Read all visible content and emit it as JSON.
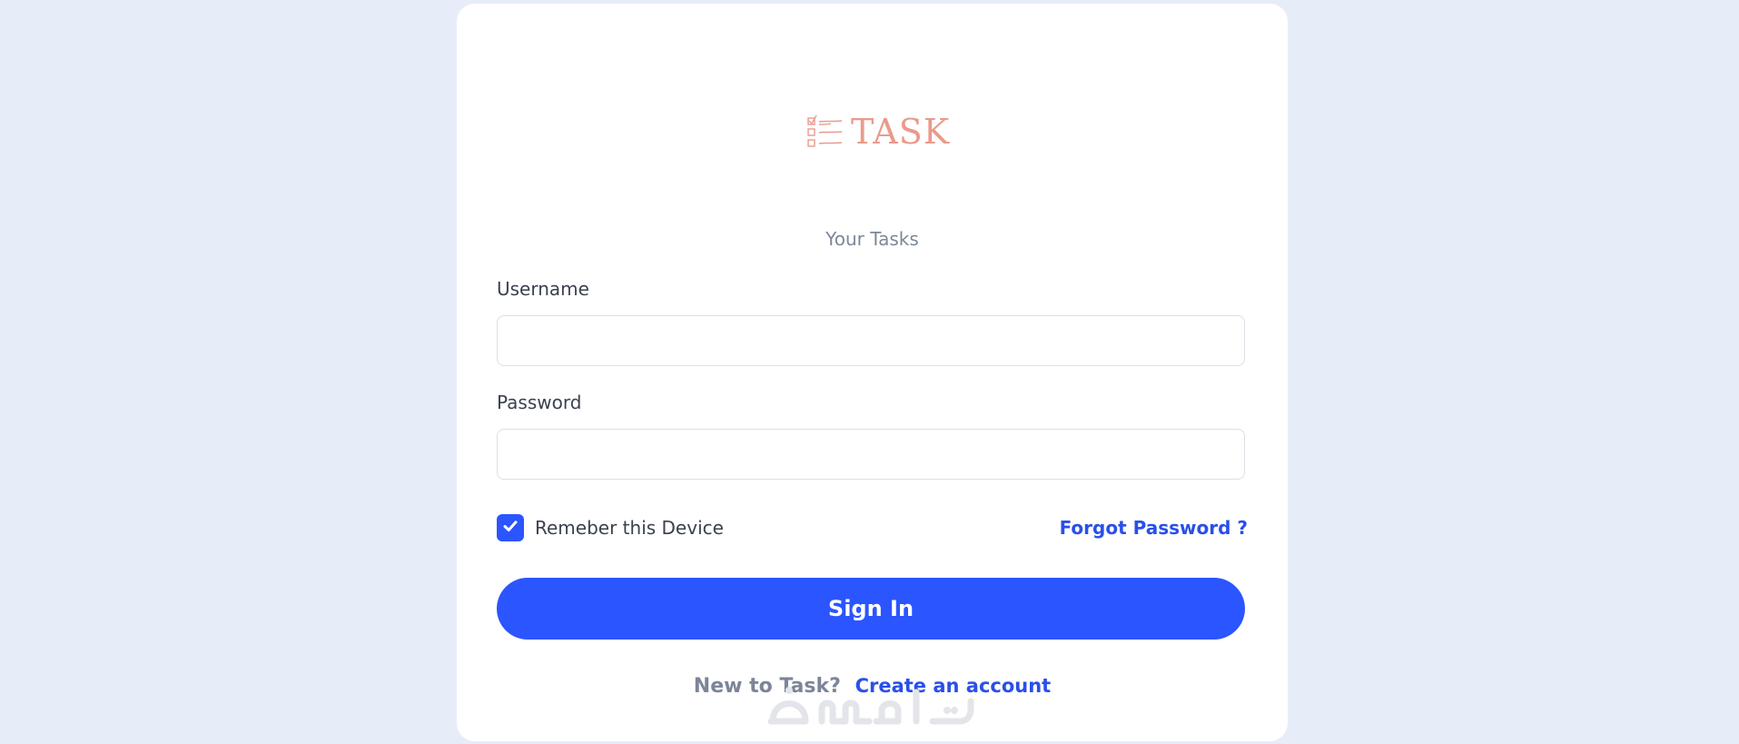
{
  "logo": {
    "text": "TASK",
    "icon": "checklist-icon",
    "color": "#ea9a8c"
  },
  "subtitle": "Your Tasks",
  "form": {
    "username_label": "Username",
    "username_value": "",
    "password_label": "Password",
    "password_value": "",
    "remember_label": "Remeber this Device",
    "remember_checked": true,
    "forgot_label": "Forgot Password ?",
    "signin_label": "Sign In"
  },
  "footer": {
    "prompt": "New to Task?",
    "create_label": "Create an account"
  },
  "watermark": {
    "text": "خمسات"
  },
  "colors": {
    "background": "#e7edf8",
    "card": "#ffffff",
    "accent": "#2b55ff",
    "link": "#2a4fe9",
    "label_text": "#3b4150",
    "muted_text": "#7d879a"
  }
}
